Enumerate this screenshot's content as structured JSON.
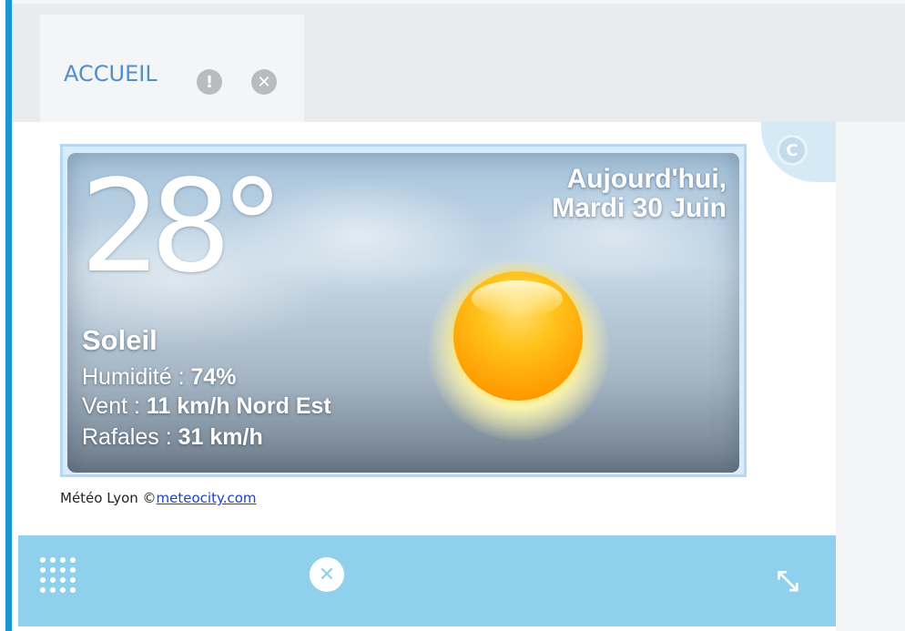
{
  "tab": {
    "label": "ACCUEIL",
    "info_icon": "info-icon",
    "close_icon": "close-icon",
    "info_glyph": "!",
    "close_glyph": "✕"
  },
  "refresh": {
    "icon": "refresh-icon",
    "glyph": "C"
  },
  "weather": {
    "temperature": "28°",
    "date_line1": "Aujourd'hui,",
    "date_line2": "Mardi 30 Juin",
    "condition": "Soleil",
    "humidity_label": "Humidité : ",
    "humidity_value": "74%",
    "wind_label": "Vent : ",
    "wind_value": "11 km/h Nord Est",
    "gusts_label": "Rafales : ",
    "gusts_value": "31 km/h",
    "icon": "sun-icon"
  },
  "credit": {
    "text": "Météo Lyon ©",
    "link": "meteocity.com"
  },
  "footer": {
    "grid_icon": "grid-icon",
    "close_icon": "close-icon",
    "close_glyph": "✕",
    "resize_icon": "resize-icon",
    "resize_glyph": "⤡"
  },
  "colors": {
    "accent": "#1a96d4",
    "tab_label": "#4f8fcd",
    "footer_bg": "#8fd0ec",
    "link": "#1a3fd6"
  }
}
